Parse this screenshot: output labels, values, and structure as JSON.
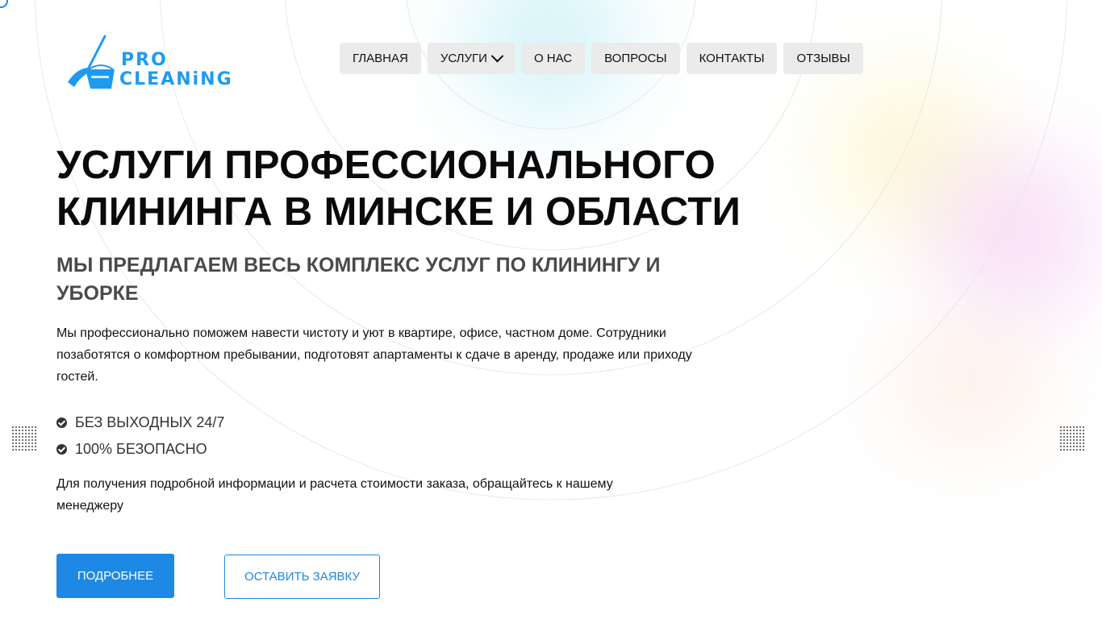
{
  "header": {
    "logo": {
      "line1": "PRO",
      "line2": "CLEANiNG",
      "accent": "#1e9bf0"
    },
    "nav": [
      {
        "label": "ГЛАВНАЯ"
      },
      {
        "label": "УСЛУГИ",
        "has_dropdown": true
      },
      {
        "label": "О НАС"
      },
      {
        "label": "ВОПРОСЫ"
      },
      {
        "label": "КОНТАКТЫ"
      },
      {
        "label": "ОТЗЫВЫ"
      }
    ]
  },
  "hero": {
    "title": "УСЛУГИ ПРОФЕССИОНАЛЬНОГО КЛИНИНГА В МИНСКЕ И ОБЛАСТИ",
    "subtitle": "МЫ ПРЕДЛАГАЕМ ВЕСЬ КОМПЛЕКС УСЛУГ ПО КЛИНИНГУ И УБОРКЕ",
    "description": "Мы профессионально поможем навести чистоту и уют в квартире, офисе, частном доме. Сотрудники позаботятся о комфортном пребывании, подготовят апартаменты к сдаче в аренду, продаже или приходу гостей.",
    "features": [
      {
        "icon": "check-circle-icon",
        "text": "БЕЗ ВЫХОДНЫХ 24/7"
      },
      {
        "icon": "check-circle-icon",
        "text": "100% БЕЗОПАСНО"
      }
    ],
    "contact_note": "Для получения подробной информации и расчета стоимости заказа, обращайтесь к нашему менеджеру",
    "buttons": {
      "more": "ПОДРОБНЕЕ",
      "request": "ОСТАВИТЬ ЗАЯВКУ"
    }
  },
  "colors": {
    "primary": "#1e88e5",
    "nav_bg": "#ebebeb",
    "text": "#0a0a0a",
    "subtitle": "#4a4a4a"
  }
}
